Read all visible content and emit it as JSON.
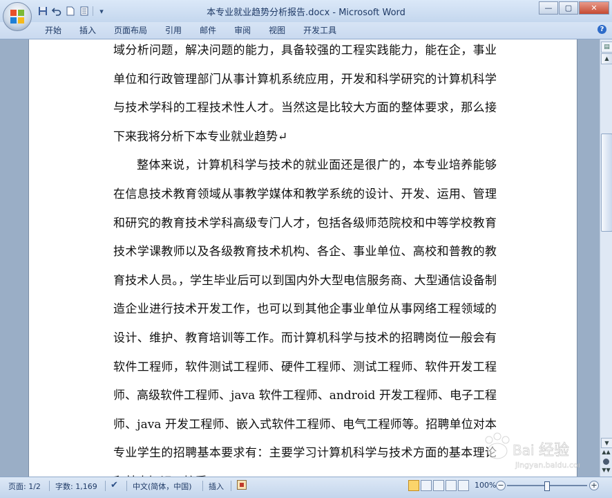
{
  "window": {
    "title": "本专业就业趋势分析报告.docx - Microsoft Word",
    "minimize_glyph": "—",
    "maximize_glyph": "▢",
    "close_glyph": "✕"
  },
  "quick_access": {
    "icons": [
      "save-icon",
      "undo-icon",
      "new-document-icon",
      "print-preview-icon",
      "customize-dropdown-icon"
    ],
    "customize_glyph": "▾"
  },
  "ribbon": {
    "tabs": [
      "开始",
      "插入",
      "页面布局",
      "引用",
      "邮件",
      "审阅",
      "视图",
      "开发工具"
    ],
    "help_glyph": "?"
  },
  "document": {
    "paragraphs": [
      {
        "indent": false,
        "text": "域分析问题，解决问题的能力，具备较强的工程实践能力，能在企，事业单位和行政管理部门从事计算机系统应用，开发和科学研究的计算机科学与技术学科的工程技术性人才。当然这是比较大方面的整体要求，那么接下来我将分析下本专业就业趋势↵"
      },
      {
        "indent": true,
        "text": "整体来说，计算机科学与技术的就业面还是很广的，本专业培养能够在信息技术教育领域从事教学媒体和教学系统的设计、开发、运用、管理和研究的教育技术学科高级专门人才，包括各级师范院校和中等学校教育技术学课教师以及各级教育技术机构、各企、事业单位、高校和普教的教育技术人员。，学生毕业后可以到国内外大型电信服务商、大型通信设备制造企业进行技术开发工作，也可以到其他企事业单位从事网络工程领域的设计、维护、教育培训等工作。而计算机科学与技术的招聘岗位一般会有软件工程师，软件测试工程师、硬件工程师、测试工程师、软件开发工程师、高级软件工程师、java 软件工程师、android 开发工程师、电子工程师、java 开发工程师、嵌入式软件工程师、电气工程师等。招聘单位对本专业学生的招聘基本要求有：主要学习计算机科学与技术方面的基本理论和基本知识，接受"
      }
    ]
  },
  "scrollbar": {
    "ruler_glyph": "▤",
    "up_glyph": "▲",
    "down_glyph": "▼",
    "prev_glyph": "▲▲",
    "next_glyph": "▼▼",
    "position_fraction": 0.25
  },
  "statusbar": {
    "page": "页面: 1/2",
    "word_count": "字数: 1,169",
    "language": "中文(简体，中国)",
    "insert_mode": "插入",
    "zoom_text": "100%",
    "zoom_level_fraction": 0.5
  },
  "watermark": {
    "text": "Baidu 经验",
    "url": "jingyan.baidu.com"
  },
  "colors": {
    "chrome": "#c4d7ee",
    "accent_title": "#1e3965",
    "page_bg": "#ffffff",
    "doc_background": "#9aaec6"
  }
}
